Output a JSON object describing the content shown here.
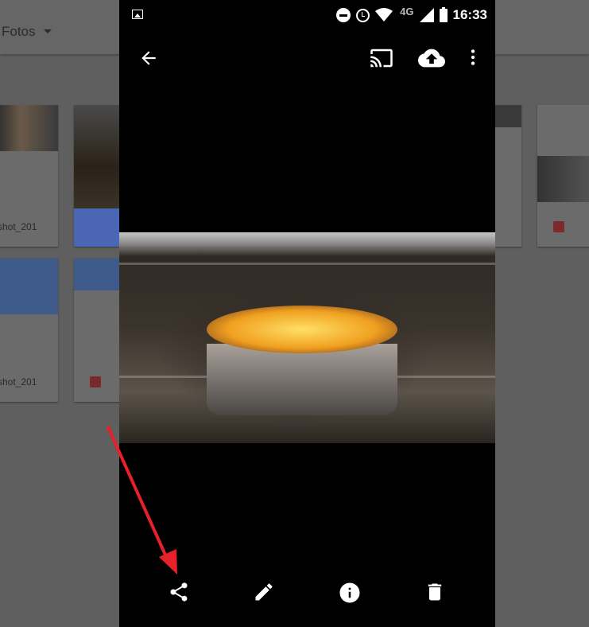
{
  "background_app": {
    "title": "Fotos",
    "cards": [
      {
        "caption": "shot_201"
      },
      {
        "caption": "shot_201"
      }
    ]
  },
  "status_bar": {
    "network": "4G",
    "time": "16:33"
  },
  "viewer": {
    "back_icon": "arrow-left-icon",
    "top_actions": [
      "cast-icon",
      "cloud-upload-icon",
      "more-vert-icon"
    ],
    "bottom_actions": [
      "share-icon",
      "edit-pencil-icon",
      "info-icon",
      "delete-trash-icon"
    ],
    "annotation_color": "#e8202a"
  }
}
